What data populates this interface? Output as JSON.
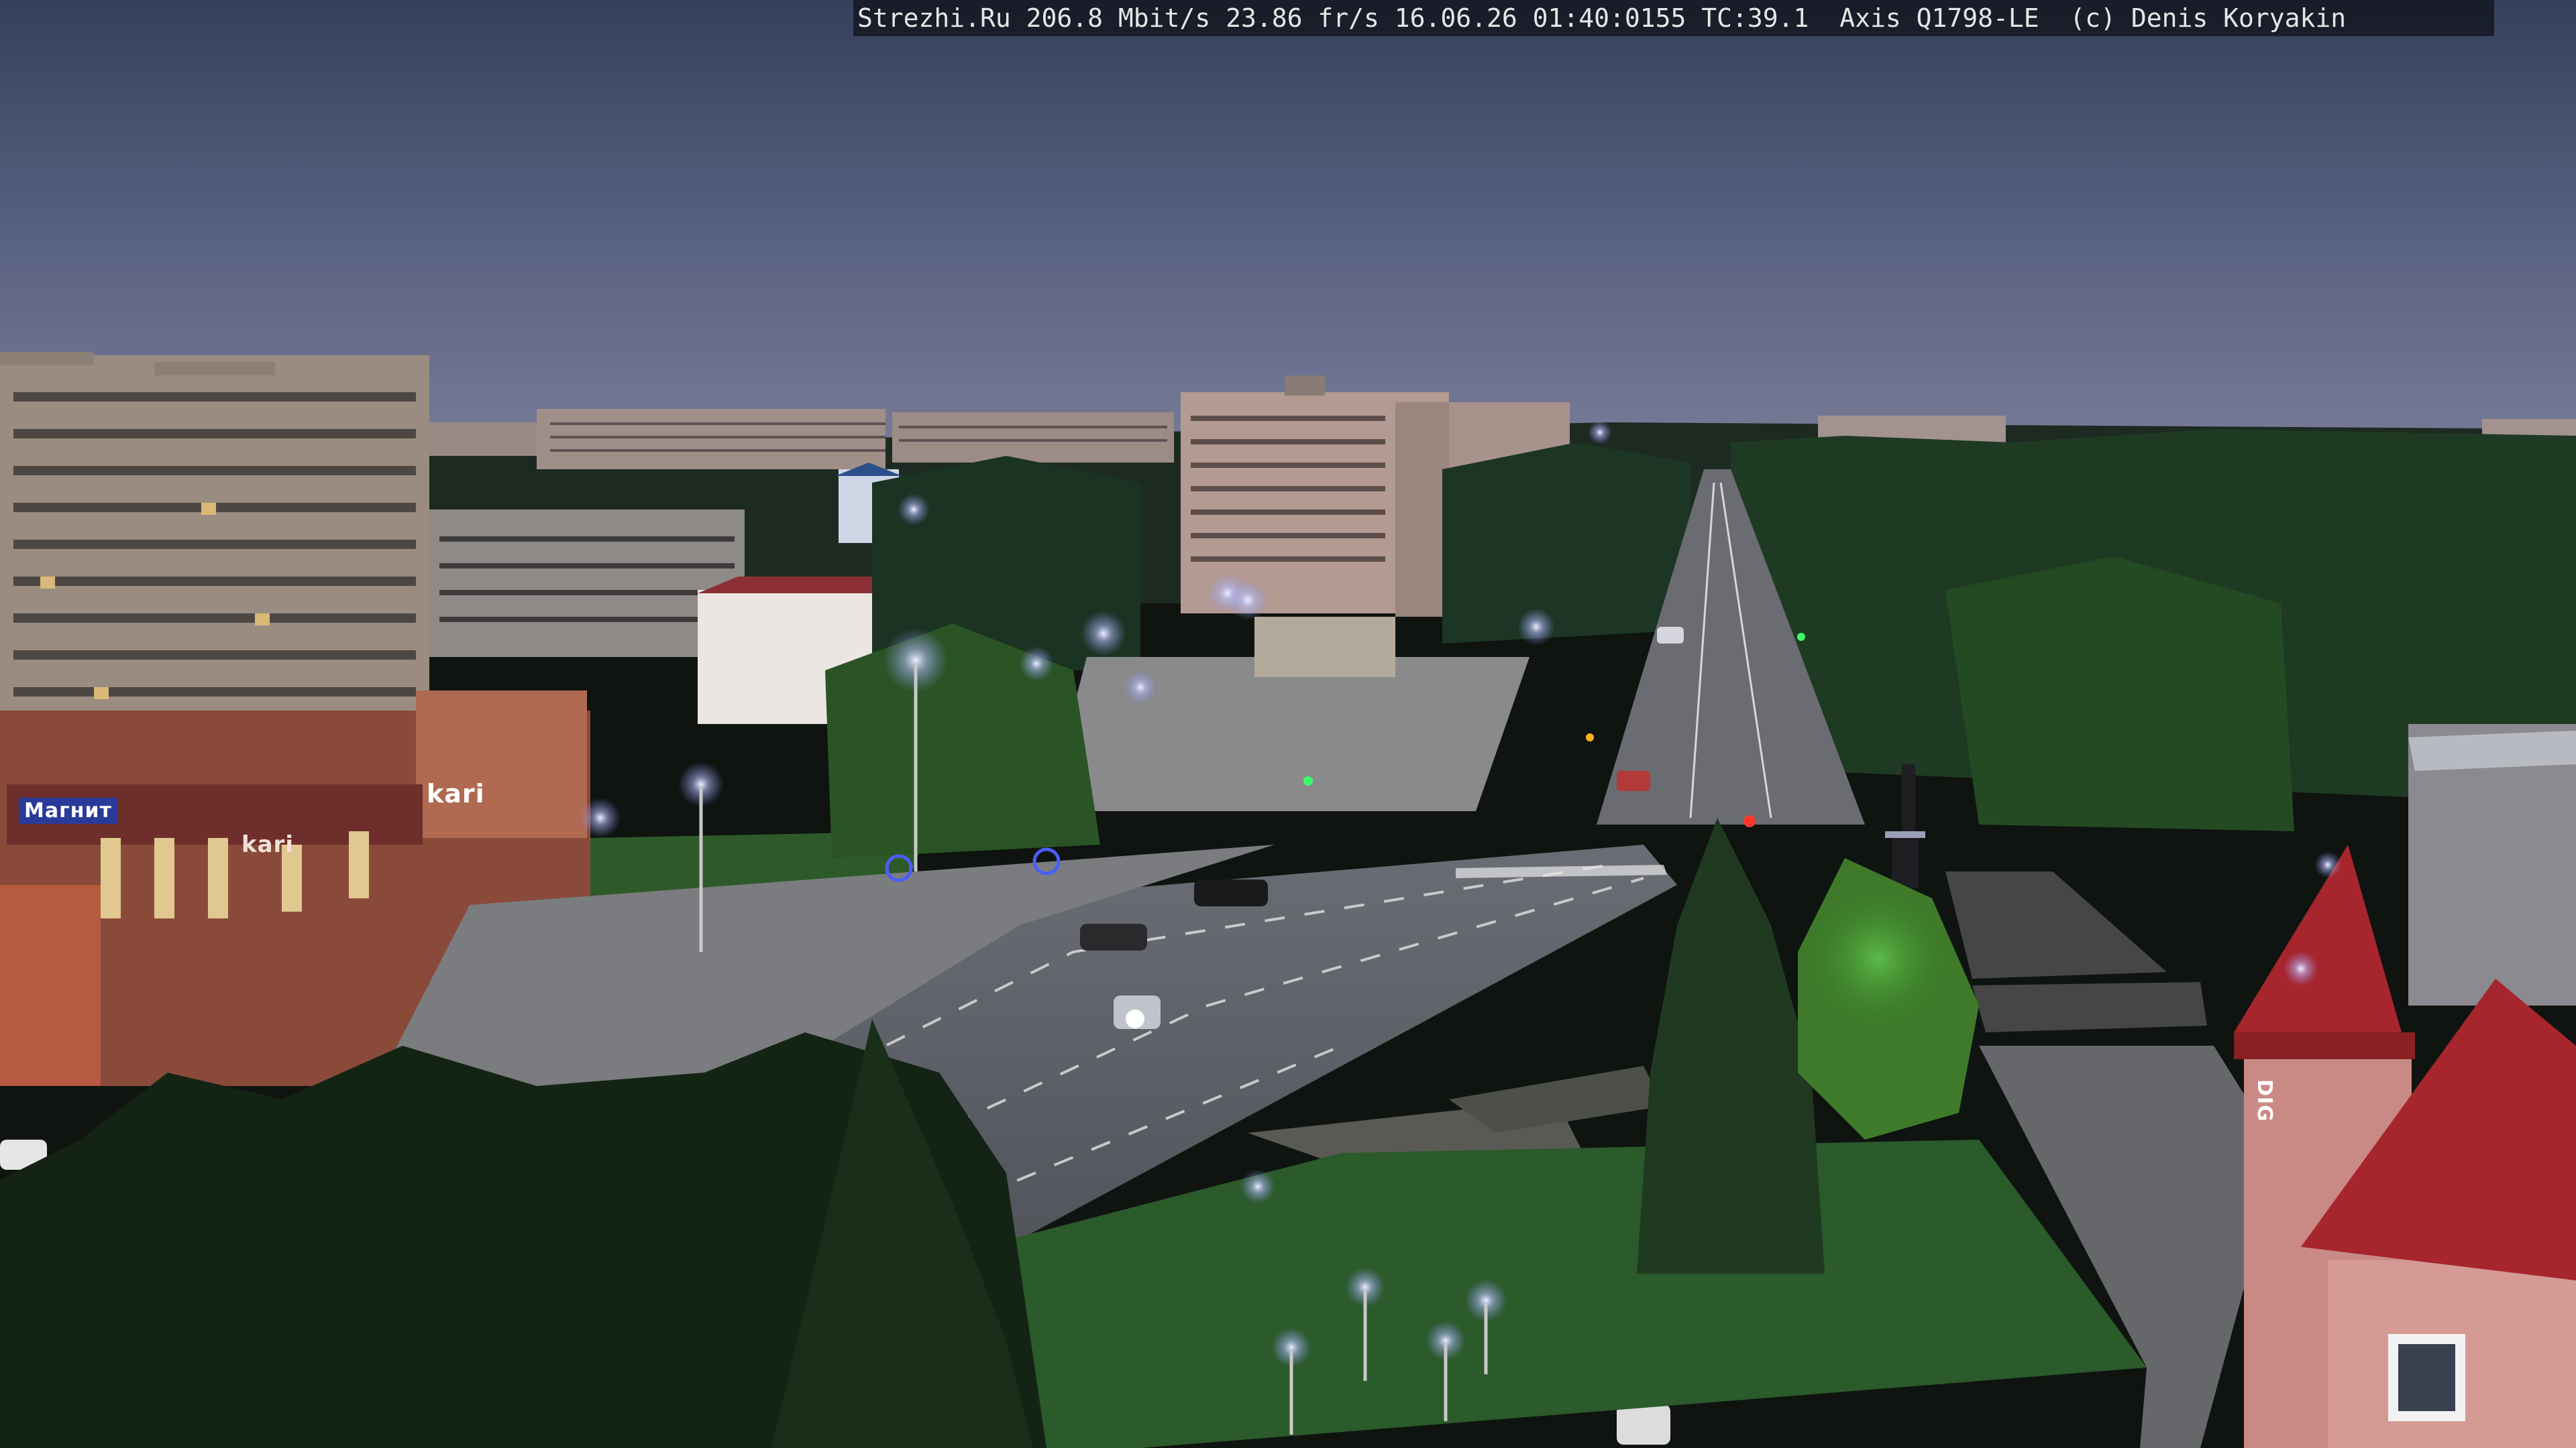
{
  "overlay": {
    "text": "Strezhi.Ru 206.8 Mbit/s 23.86 fr/s 16.06.26 01:40:0155 TC:39.1  Axis Q1798-LE  (c) Denis Koryakin"
  },
  "storefront": {
    "kari_sign": "kari",
    "blue_sign": "Магнит",
    "store_sign": "kari"
  },
  "tower_sign": "DIG",
  "palette": {
    "sky_top": "#3a4460",
    "sky_bottom": "#6a6f8f",
    "trees": "#1e3a22",
    "road": "#5c5f66",
    "lamp": "#d8ddff"
  }
}
